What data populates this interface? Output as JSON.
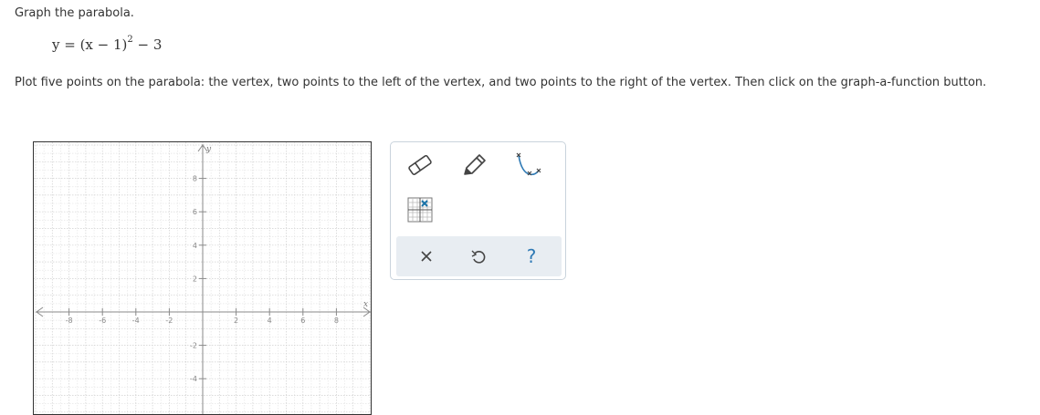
{
  "question": {
    "title": "Graph the parabola.",
    "equation": {
      "lhs": "y = (x − 1)",
      "exponent": "2",
      "rhs": " − 3"
    },
    "instructions": "Plot five points on the parabola: the vertex, two points to the left of the vertex, and two points to the right of the vertex. Then click on the graph-a-function button."
  },
  "graph": {
    "x_axis_label": "x",
    "y_axis_label": "y",
    "x_tick_labels": [
      "-8",
      "-6",
      "-4",
      "-2",
      "2",
      "4",
      "6",
      "8"
    ],
    "y_tick_labels": [
      "8",
      "6",
      "4",
      "2",
      "-2",
      "-4"
    ],
    "x_range": [
      -10,
      10
    ],
    "y_range": [
      -6,
      10
    ]
  },
  "toolbar": {
    "tools": [
      {
        "icon": "eraser-icon"
      },
      {
        "icon": "pencil-icon"
      },
      {
        "icon": "graph-function-icon"
      },
      {
        "icon": "point-grid-icon"
      }
    ],
    "actions": [
      {
        "icon": "close-icon"
      },
      {
        "icon": "undo-icon"
      },
      {
        "icon": "help-icon",
        "label": "?"
      }
    ],
    "colors": {
      "accent": "#2f7ab5",
      "marker": "#1a73a8",
      "bar_bg": "#e8edf2"
    }
  }
}
